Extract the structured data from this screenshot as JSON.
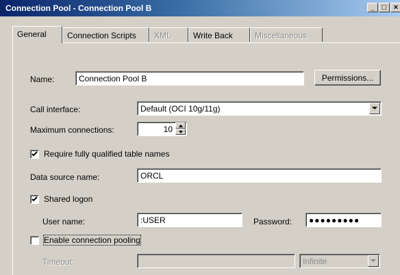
{
  "window": {
    "title": "Connection Pool - Connection Pool B",
    "minimize": "_",
    "maximize": "□",
    "close": "×"
  },
  "tabs": [
    {
      "label": "General",
      "active": true,
      "enabled": true
    },
    {
      "label": "Connection Scripts",
      "active": false,
      "enabled": true
    },
    {
      "label": "XML",
      "active": false,
      "enabled": false
    },
    {
      "label": "Write Back",
      "active": false,
      "enabled": true
    },
    {
      "label": "Miscellaneous",
      "active": false,
      "enabled": false
    }
  ],
  "form": {
    "name_label": "Name:",
    "name_value": "Connection Pool B",
    "permissions_button": "Permissions...",
    "call_interface_label": "Call interface:",
    "call_interface_value": "Default (OCI 10g/11g)",
    "max_connections_label": "Maximum connections:",
    "max_connections_value": "10",
    "require_fq_label": "Require fully qualified table names",
    "require_fq_checked": true,
    "dsn_label": "Data source name:",
    "dsn_value": "ORCL",
    "shared_logon_label": "Shared logon",
    "shared_logon_checked": true,
    "username_label": "User name:",
    "username_value": ":USER",
    "password_label": "Password:",
    "password_value": "●●●●●●●●●",
    "pooling_label": "Enable connection pooling",
    "pooling_checked": false,
    "timeout_label": "Timeout:",
    "timeout_value": "",
    "timeout_unit": "Infinite"
  }
}
